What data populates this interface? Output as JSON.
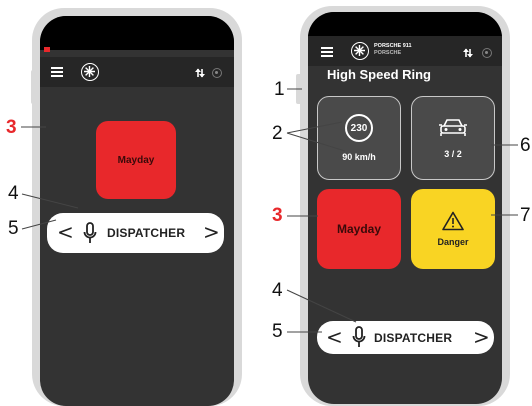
{
  "left_phone": {
    "mayday_label": "Mayday",
    "dispatcher_label": "DISPATCHER",
    "prev_chevron": "<",
    "next_chevron": ">"
  },
  "right_phone": {
    "brand_line1": "PORSCHE 911",
    "brand_line2": "PORSCHE",
    "track_title": "High Speed Ring",
    "speed_limit": "230",
    "current_speed": "90 km/h",
    "cars_count": "3 / 2",
    "mayday_label": "Mayday",
    "danger_label": "Danger",
    "dispatcher_label": "DISPATCHER",
    "prev_chevron": "<",
    "next_chevron": ">"
  },
  "callouts": {
    "left": [
      "3",
      "4",
      "5"
    ],
    "right": [
      "1",
      "2",
      "3",
      "4",
      "5",
      "6",
      "7"
    ]
  },
  "colors": {
    "mayday": "#e8282b",
    "danger": "#f9d423",
    "screen": "#333333",
    "frame": "#d9d9d9"
  }
}
